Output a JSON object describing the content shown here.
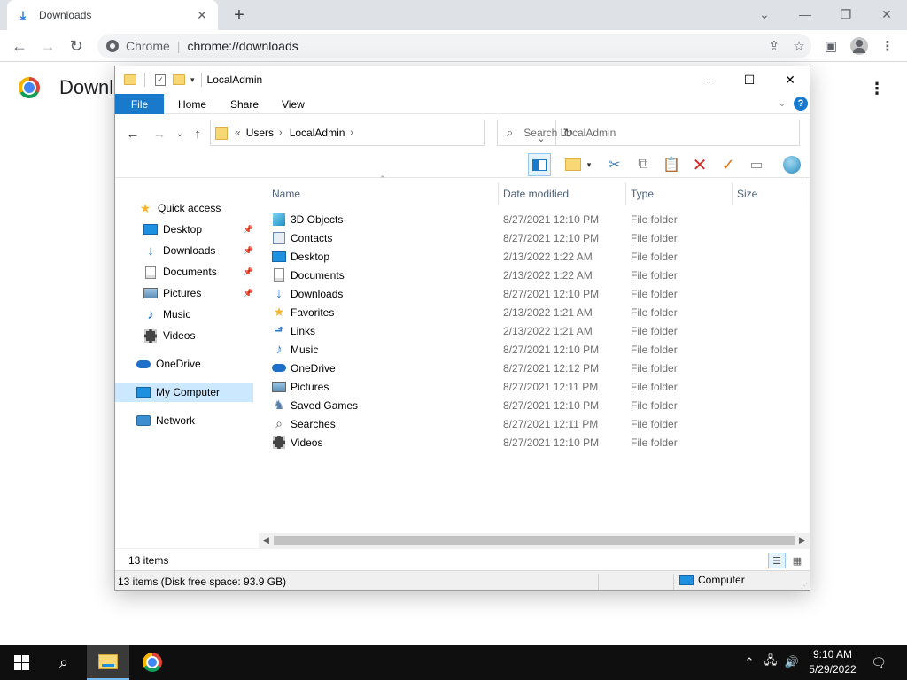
{
  "chrome": {
    "tab_title": "Downloads",
    "omnibox_site": "Chrome",
    "omnibox_url": "chrome://downloads",
    "page_title": "Downloads"
  },
  "explorer": {
    "title": "LocalAdmin",
    "ribbon_tabs": [
      "File",
      "Home",
      "Share",
      "View"
    ],
    "breadcrumb": [
      "Users",
      "LocalAdmin"
    ],
    "breadcrumb_prefix": "«",
    "search_placeholder": "Search LocalAdmin",
    "columns": [
      "Name",
      "Date modified",
      "Type",
      "Size"
    ],
    "nav": [
      {
        "label": "Quick access",
        "icon": "star-icon",
        "pinned": false
      },
      {
        "label": "Desktop",
        "icon": "desktop-icon",
        "pinned": true
      },
      {
        "label": "Downloads",
        "icon": "download-arrow-icon",
        "pinned": true
      },
      {
        "label": "Documents",
        "icon": "document-icon",
        "pinned": true
      },
      {
        "label": "Pictures",
        "icon": "picture-icon",
        "pinned": true
      },
      {
        "label": "Music",
        "icon": "music-note-icon",
        "pinned": false
      },
      {
        "label": "Videos",
        "icon": "film-icon",
        "pinned": false
      },
      {
        "label": "OneDrive",
        "icon": "cloud-icon",
        "pinned": false
      },
      {
        "label": "My Computer",
        "icon": "computer-icon",
        "pinned": false
      },
      {
        "label": "Network",
        "icon": "network-icon",
        "pinned": false
      }
    ],
    "files": [
      {
        "name": "3D Objects",
        "date": "8/27/2021 12:10 PM",
        "type": "File folder",
        "icon": "cube-icon"
      },
      {
        "name": "Contacts",
        "date": "8/27/2021 12:10 PM",
        "type": "File folder",
        "icon": "contacts-icon"
      },
      {
        "name": "Desktop",
        "date": "2/13/2022 1:22 AM",
        "type": "File folder",
        "icon": "desktop-icon"
      },
      {
        "name": "Documents",
        "date": "2/13/2022 1:22 AM",
        "type": "File folder",
        "icon": "document-icon"
      },
      {
        "name": "Downloads",
        "date": "8/27/2021 12:10 PM",
        "type": "File folder",
        "icon": "download-arrow-icon"
      },
      {
        "name": "Favorites",
        "date": "2/13/2022 1:21 AM",
        "type": "File folder",
        "icon": "star-icon"
      },
      {
        "name": "Links",
        "date": "2/13/2022 1:21 AM",
        "type": "File folder",
        "icon": "link-arrow-icon"
      },
      {
        "name": "Music",
        "date": "8/27/2021 12:10 PM",
        "type": "File folder",
        "icon": "music-note-icon"
      },
      {
        "name": "OneDrive",
        "date": "8/27/2021 12:12 PM",
        "type": "File folder",
        "icon": "cloud-icon"
      },
      {
        "name": "Pictures",
        "date": "8/27/2021 12:11 PM",
        "type": "File folder",
        "icon": "picture-icon"
      },
      {
        "name": "Saved Games",
        "date": "8/27/2021 12:10 PM",
        "type": "File folder",
        "icon": "games-icon"
      },
      {
        "name": "Searches",
        "date": "8/27/2021 12:11 PM",
        "type": "File folder",
        "icon": "search-icon"
      },
      {
        "name": "Videos",
        "date": "8/27/2021 12:10 PM",
        "type": "File folder",
        "icon": "film-icon"
      }
    ],
    "item_count": "13 items",
    "status_detail": "13 items (Disk free space: 93.9 GB)",
    "status_location": "Computer"
  },
  "taskbar": {
    "time": "9:10 AM",
    "date": "5/29/2022"
  }
}
